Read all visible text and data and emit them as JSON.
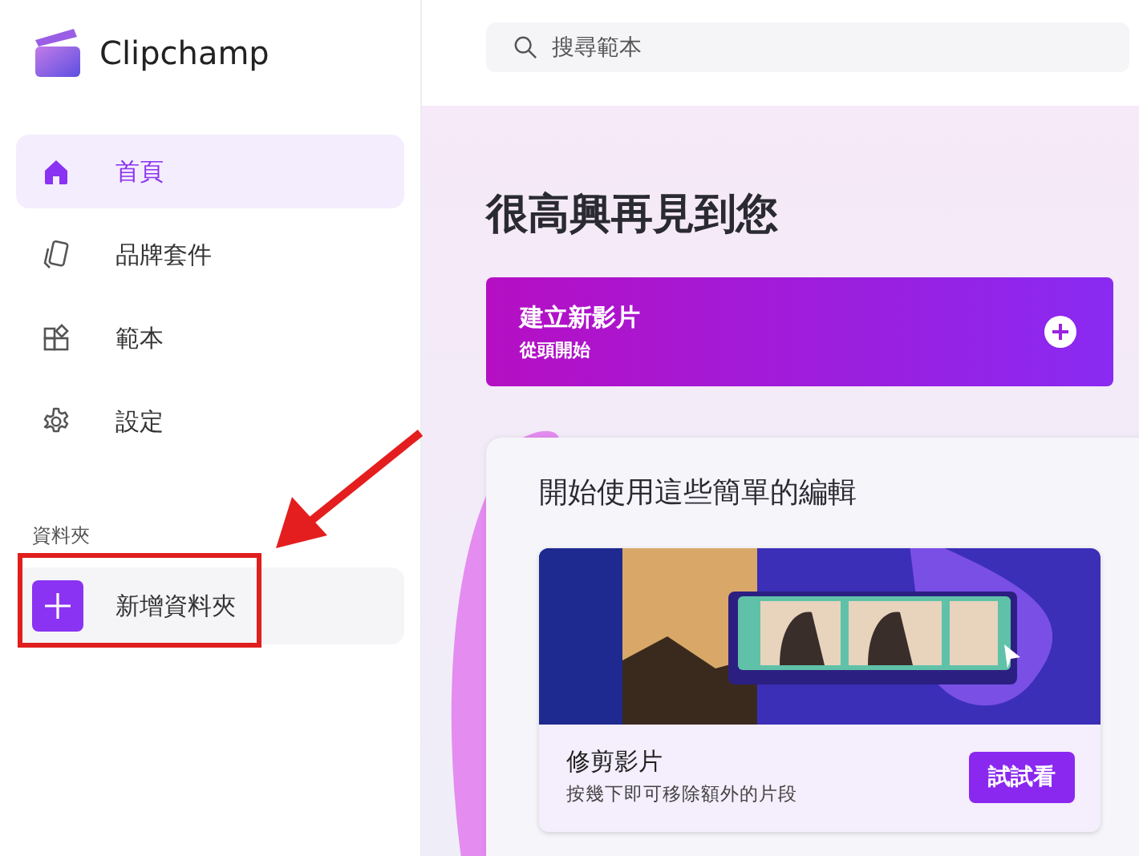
{
  "app": {
    "name": "Clipchamp"
  },
  "sidebar": {
    "items": [
      {
        "label": "首頁",
        "selected": true
      },
      {
        "label": "品牌套件",
        "selected": false
      },
      {
        "label": "範本",
        "selected": false
      },
      {
        "label": "設定",
        "selected": false
      }
    ],
    "section": "資料夾",
    "new_folder": "新增資料夾"
  },
  "search": {
    "placeholder": "搜尋範本"
  },
  "heading": "很高興再見到您",
  "create_card": {
    "title": "建立新影片",
    "subtitle": "從頭開始"
  },
  "panel": {
    "title": "開始使用這些簡單的編輯",
    "cards": [
      {
        "kind": "picture",
        "title": "修剪影片",
        "description": "按幾下即可移除額外的片段",
        "button": "試試看"
      }
    ]
  }
}
